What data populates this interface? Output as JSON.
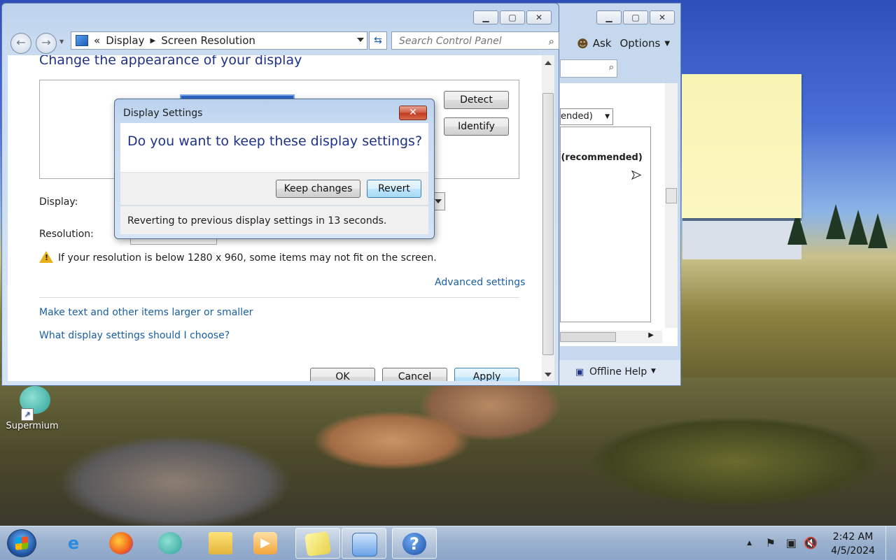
{
  "desktop": {
    "icon_label": "Supermium"
  },
  "help_window": {
    "toolbar": {
      "ask": "Ask",
      "options": "Options"
    },
    "search_icon": "search-icon",
    "combo_fragment": "ended)",
    "recommended_fragment": ") (recommended)",
    "offline_help": "Offline Help"
  },
  "main_window": {
    "breadcrumb": {
      "root_sep": "«",
      "item1": "Display",
      "item2": "Screen Resolution"
    },
    "search_placeholder": "Search Control Panel",
    "heading": "Change the appearance of your display",
    "detect_label": "Detect",
    "identify_label": "Identify",
    "display_label": "Display:",
    "resolution_label": "Resolution:",
    "warning_text": "If your resolution is below 1280 x 960, some items may not fit on the screen.",
    "advanced_settings": "Advanced settings",
    "link_text_size": "Make text and other items larger or smaller",
    "link_which_settings": "What display settings should I choose?",
    "ok_label": "OK",
    "cancel_label": "Cancel",
    "apply_label": "Apply"
  },
  "dialog": {
    "title": "Display Settings",
    "question": "Do you want to keep these display settings?",
    "keep_label": "Keep changes",
    "revert_label": "Revert",
    "status": "Reverting to previous display settings in 13 seconds."
  },
  "taskbar": {
    "apps": [
      "internet-explorer",
      "firefox",
      "supermium",
      "file-explorer",
      "media-player",
      "sticky-notes",
      "control-panel",
      "help"
    ],
    "time": "2:42 AM",
    "date": "4/5/2024"
  }
}
